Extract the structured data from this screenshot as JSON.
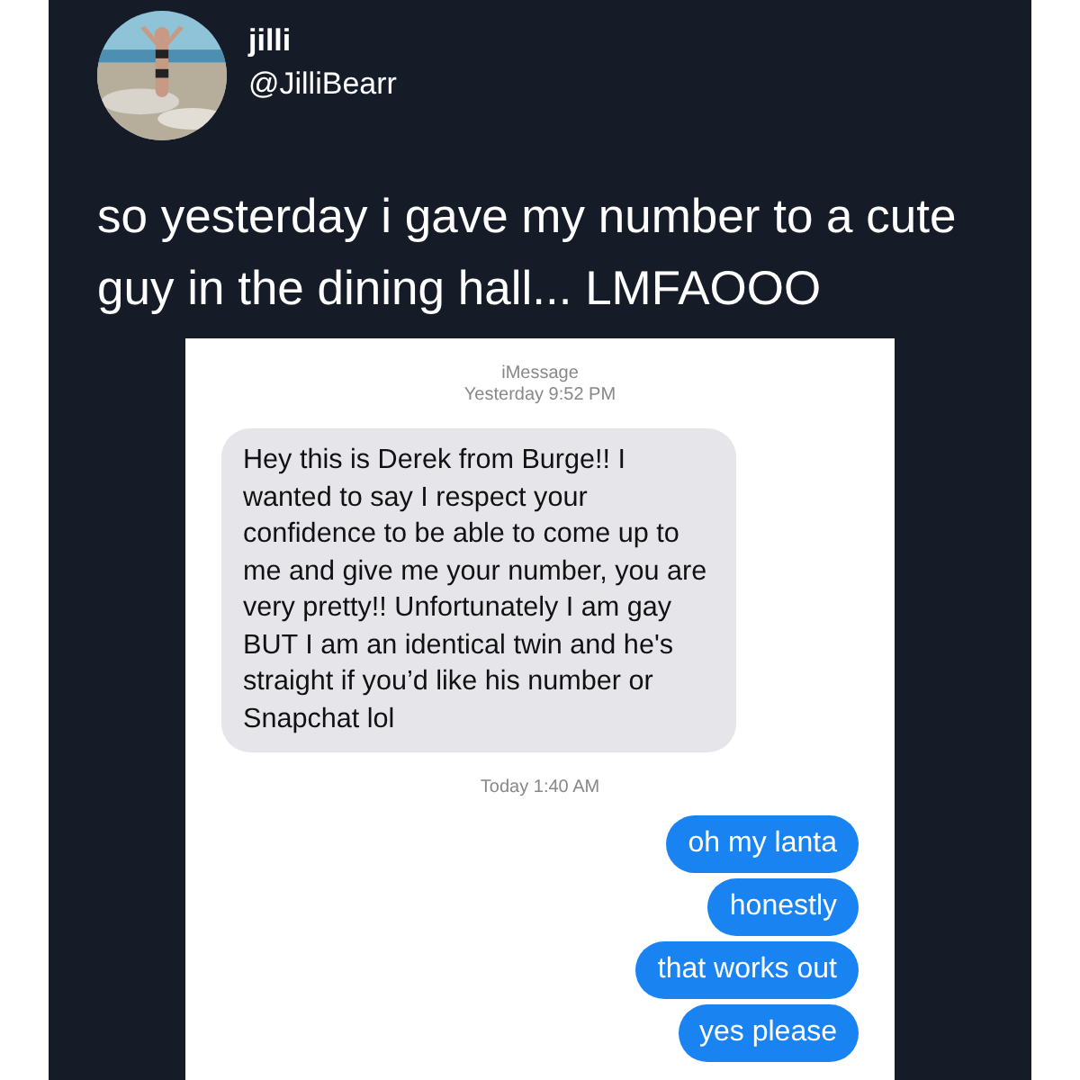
{
  "tweet": {
    "author_name": "jilli",
    "handle": "@JilliBearr",
    "text": "so yesterday i gave my number to a cute guy in the dining hall... LMFAOOO"
  },
  "screenshot": {
    "service": "iMessage",
    "timestamp": "Yesterday 9:52 PM",
    "items": [
      {
        "kind": "incoming",
        "text": "Hey this is Derek from Burge!! I wanted to say I respect your confidence to be able to come up to me and give me your number, you are very pretty!! Unfortunately I am gay BUT I am an identical twin and he's straight if you’d like his number or Snapchat lol"
      },
      {
        "kind": "timestamp",
        "text": "Today 1:40 AM"
      },
      {
        "kind": "outgoing",
        "text": "oh my lanta"
      },
      {
        "kind": "outgoing",
        "text": "honestly"
      },
      {
        "kind": "outgoing",
        "text": "that works out"
      },
      {
        "kind": "outgoing",
        "text": "yes please"
      }
    ]
  }
}
